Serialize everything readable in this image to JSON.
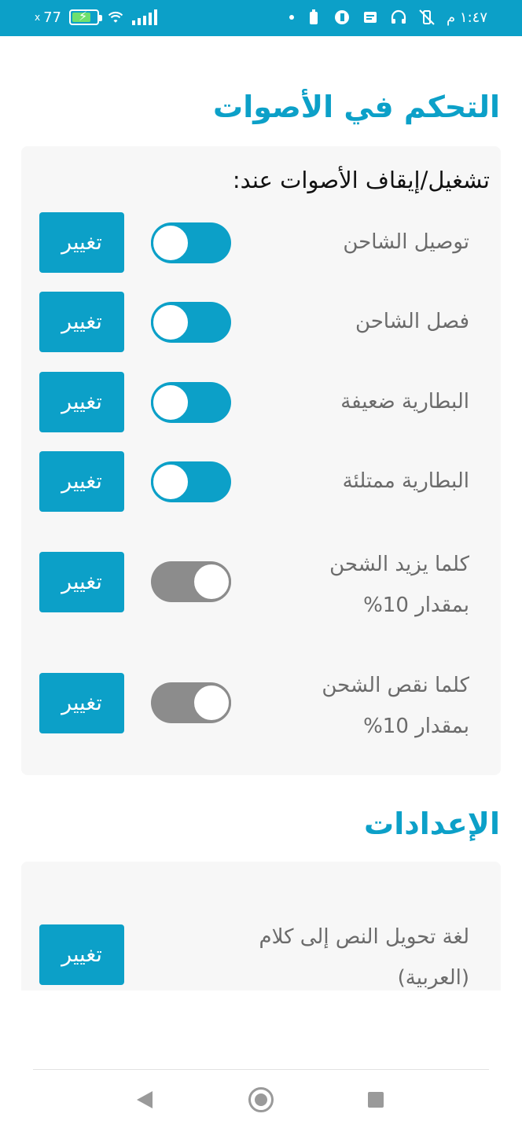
{
  "status_bar": {
    "battery_level": "77",
    "battery_prefix": "x",
    "battery_fill_pct": 77,
    "time": "١:٤٧ م"
  },
  "sound_section": {
    "title": "التحكم في الأصوات",
    "subtitle": "تشغيل/إيقاف الأصوات عند:",
    "items": [
      {
        "label": "توصيل الشاحن",
        "enabled": true,
        "button": "تغيير"
      },
      {
        "label": "فصل الشاحن",
        "enabled": true,
        "button": "تغيير"
      },
      {
        "label": "البطارية ضعيفة",
        "enabled": true,
        "button": "تغيير"
      },
      {
        "label": "البطارية ممتلئة",
        "enabled": true,
        "button": "تغيير"
      },
      {
        "label_line1": "كلما يزيد الشحن",
        "label_line2": "بمقدار 10%",
        "enabled": false,
        "button": "تغيير"
      },
      {
        "label_line1": "كلما نقص الشحن",
        "label_line2": "بمقدار 10%",
        "enabled": false,
        "button": "تغيير"
      }
    ]
  },
  "settings_section": {
    "title": "الإعدادات",
    "items": [
      {
        "label_line1": "لغة تحويل النص إلى كلام",
        "label_line2": "(العربية)",
        "button": "تغيير"
      }
    ]
  },
  "colors": {
    "accent": "#0ca0c8",
    "toggle_off": "#8c8c8c",
    "card_bg": "#f7f7f7"
  }
}
